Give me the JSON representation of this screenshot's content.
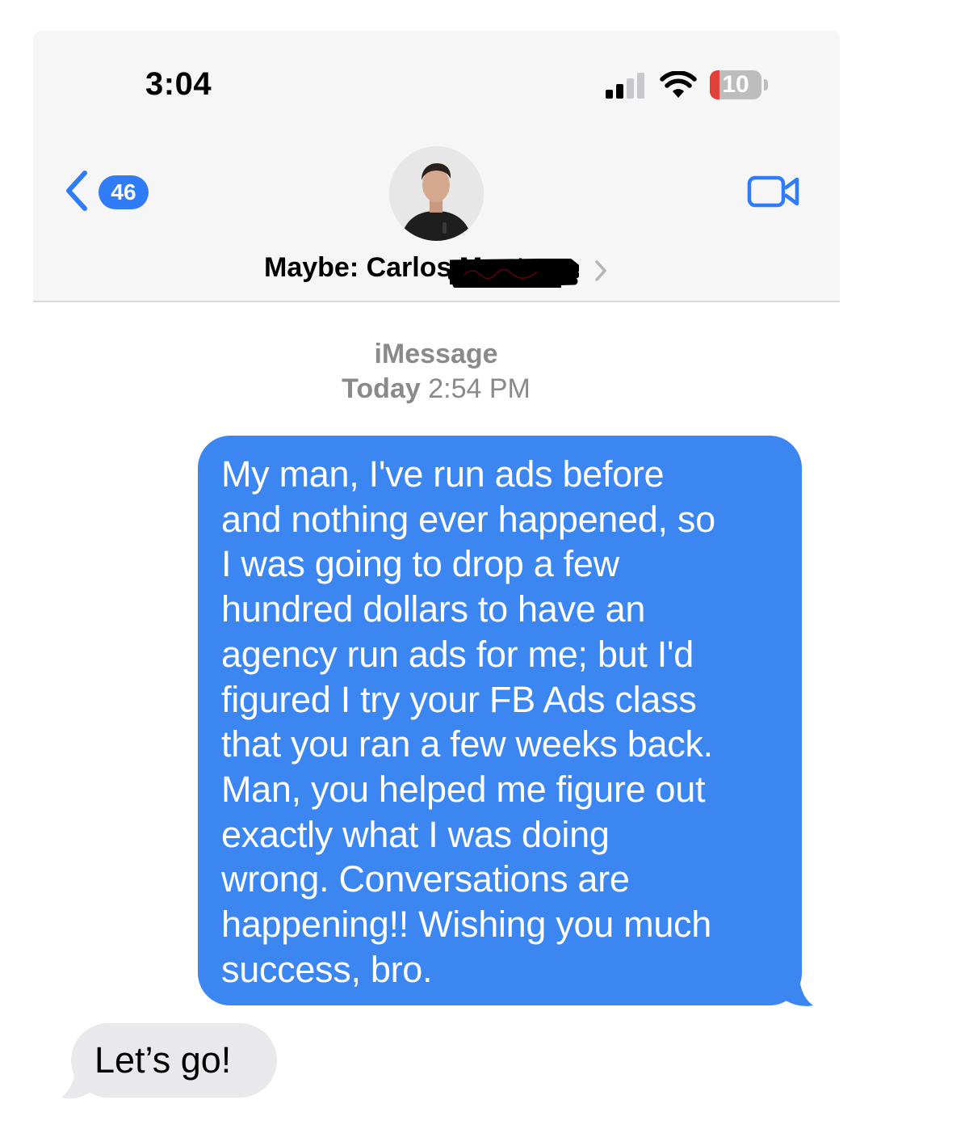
{
  "status_bar": {
    "time": "3:04",
    "battery_level": "10",
    "battery_fraction": 0.1,
    "signal_bars_active": 2,
    "signal_bars_total": 4
  },
  "nav": {
    "back_count": "46",
    "contact_name": "Maybe: Carlos Montoya",
    "icons": [
      "chevron-left-icon",
      "video-camera-icon",
      "chevron-right-icon"
    ]
  },
  "thread": {
    "service": "iMessage",
    "timestamp_day": "Today",
    "timestamp_time": "2:54 PM",
    "messages": [
      {
        "direction": "outgoing",
        "text": "My man, I've run ads before\nand nothing ever happened, so\nI was going to drop a few\nhundred dollars to have an\nagency run ads for me; but I'd\nfigured I try your FB Ads class\nthat you ran a few weeks back.\nMan, you helped me figure out\nexactly what I was doing\nwrong. Conversations are\nhappening!! Wishing you much\nsuccess, bro."
      },
      {
        "direction": "incoming",
        "text": "Let’s go!"
      }
    ]
  },
  "colors": {
    "accent_blue": "#2f7cf6",
    "bubble_blue": "#3b86f1",
    "bubble_gray": "#e9e9eb",
    "header_bg": "#f6f6f6",
    "battery_low": "#e0413a",
    "secondary_text": "#8a8a8e"
  }
}
